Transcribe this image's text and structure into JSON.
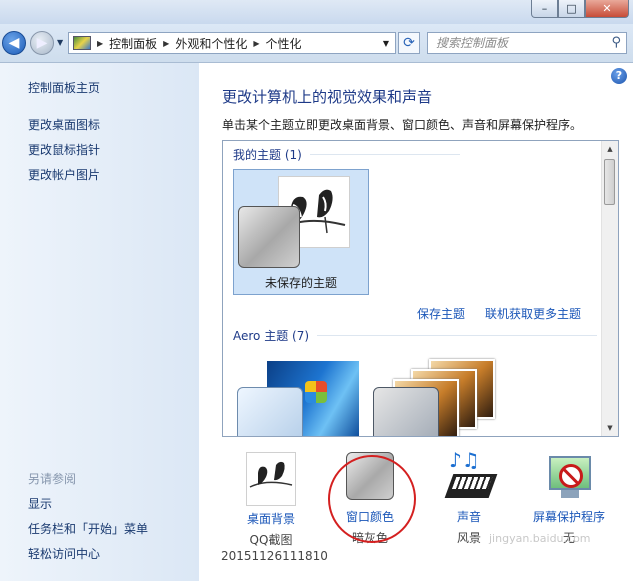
{
  "window": {
    "controls": {
      "minimize": "–",
      "maximize": "□",
      "close": "✕"
    }
  },
  "nav": {
    "back_icon": "back-arrow-icon",
    "forward_icon": "forward-arrow-icon",
    "breadcrumbs": [
      "控制面板",
      "外观和个性化",
      "个性化"
    ],
    "search_placeholder": "搜索控制面板"
  },
  "sidebar": {
    "items": [
      {
        "label": "控制面板主页"
      },
      {
        "label": "更改桌面图标"
      },
      {
        "label": "更改鼠标指针"
      },
      {
        "label": "更改帐户图片"
      }
    ],
    "see_also_title": "另请参阅",
    "see_also": [
      {
        "label": "显示"
      },
      {
        "label": "任务栏和「开始」菜单"
      },
      {
        "label": "轻松访问中心"
      }
    ]
  },
  "main": {
    "title": "更改计算机上的视觉效果和声音",
    "description": "单击某个主题立即更改桌面背景、窗口颜色、声音和屏幕保护程序。",
    "my_themes": {
      "header": "我的主题 (1)",
      "items": [
        {
          "label": "未保存的主题",
          "selected": true
        }
      ],
      "save_link": "保存主题",
      "more_link": "联机获取更多主题"
    },
    "aero_themes": {
      "header": "Aero 主题 (7)"
    }
  },
  "bottom": {
    "items": [
      {
        "label": "桌面背景",
        "sub": "QQ截图"
      },
      {
        "label": "窗口颜色",
        "sub": "暗灰色"
      },
      {
        "label": "声音",
        "sub": "风景"
      },
      {
        "label": "屏幕保护程序",
        "sub": "无"
      }
    ],
    "timestamp": "20151126111810"
  },
  "watermark": "jingyan.baidu.com",
  "colors": {
    "link": "#1a56b8",
    "title": "#1e3a88",
    "annotation_circle": "#d42020"
  }
}
